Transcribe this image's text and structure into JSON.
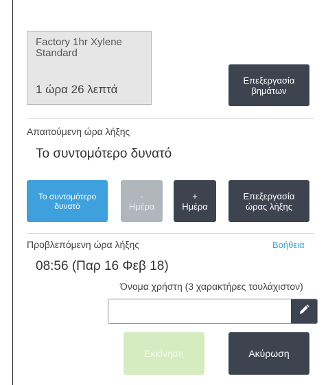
{
  "protocol": {
    "name": "Factory 1hr Xylene Standard",
    "duration": "1 ώρα 26 λεπτά",
    "edit_steps_line1": "Επεξεργασία",
    "edit_steps_line2": "βημάτων"
  },
  "required_end": {
    "label": "Απαιτούμενη ώρα λήξης",
    "value": "Το συντομότερο δυνατό",
    "asap_line1": "Το συντομότερο",
    "asap_line2": "δυνατό",
    "minus_symbol": "-",
    "minus_label": "Ημέρα",
    "plus_symbol": "+",
    "plus_label": "Ημέρα",
    "edit_end_line1": "Επεξεργασία",
    "edit_end_line2": "ώρας λήξης"
  },
  "predicted_end": {
    "label": "Προβλεπόμενη ώρα λήξης",
    "help": "Βοήθεια",
    "value": "08:56 (Παρ 16 Φεβ 18)"
  },
  "user": {
    "label": "Όνομα χρήστη (3 χαρακτήρες τουλάχιστον)",
    "value": ""
  },
  "actions": {
    "start": "Εκκίνηση",
    "cancel": "Ακύρωση"
  },
  "colors": {
    "dark_button": "#3d4450",
    "blue_button": "#3ea0dc",
    "disabled_button": "#b1b6bd",
    "start_disabled": "#d4ecc0",
    "help_link": "#3ea0dc"
  },
  "icons": [
    "pencil-icon"
  ]
}
